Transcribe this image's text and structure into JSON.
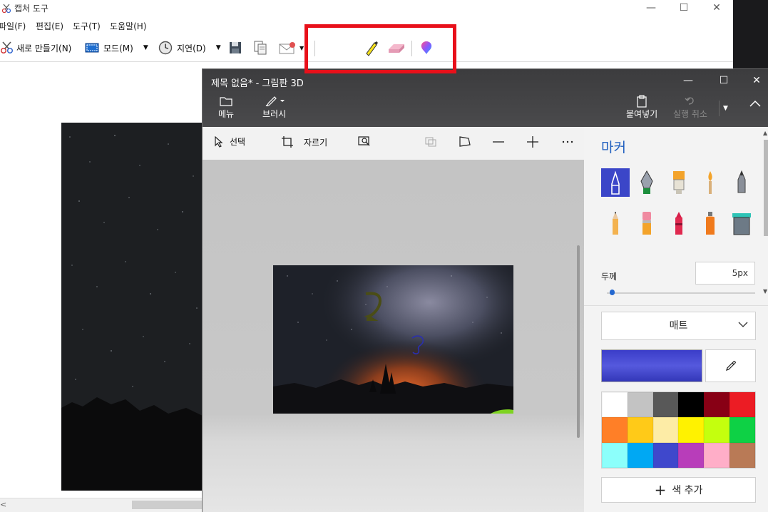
{
  "snip": {
    "title": "캡처 도구",
    "menu": [
      "파일(F)",
      "편집(E)",
      "도구(T)",
      "도움말(H)"
    ],
    "toolbar": {
      "new_label": "새로 만들기(N)",
      "mode_label": "모드(M)",
      "delay_label": "지연(D)"
    },
    "window_controls": {
      "minimize": "—",
      "maximize": "☐",
      "close": "✕"
    },
    "scroll_arrow": "<"
  },
  "paint": {
    "title": "제목 없음* - 그림판 3D",
    "commands": {
      "menu": "메뉴",
      "brush": "브러시",
      "paste": "붙여넣기",
      "undo": "실행 취소"
    },
    "subbar": {
      "select": "선택",
      "crop": "자르기"
    },
    "window_controls": {
      "minimize": "—",
      "maximize": "☐",
      "close": "✕"
    },
    "panel": {
      "title": "마커",
      "thickness_label": "두께",
      "thickness_value": "5px",
      "thickness_level": 0.02,
      "finish": "매트",
      "add_color": "색 추가",
      "current_color": "#3f43cc",
      "palette": [
        "#ffffff",
        "#c3c3c3",
        "#585858",
        "#000000",
        "#880015",
        "#ec1c24",
        "#ff7f27",
        "#ffca18",
        "#fdeca6",
        "#fff200",
        "#c4ff0e",
        "#0ed145",
        "#8cfffb",
        "#00a8f3",
        "#3f48cc",
        "#b83dba",
        "#ffaec8",
        "#b97a56"
      ],
      "tools": [
        "marker-tool",
        "calligraphy-pen-tool",
        "oil-brush-tool",
        "watercolor-tool",
        "pixel-pen-tool",
        "pencil-tool",
        "eraser-tool",
        "crayon-tool",
        "spray-can-tool",
        "fill-tool"
      ]
    }
  },
  "accent": {
    "highlight": "#e8101a"
  }
}
